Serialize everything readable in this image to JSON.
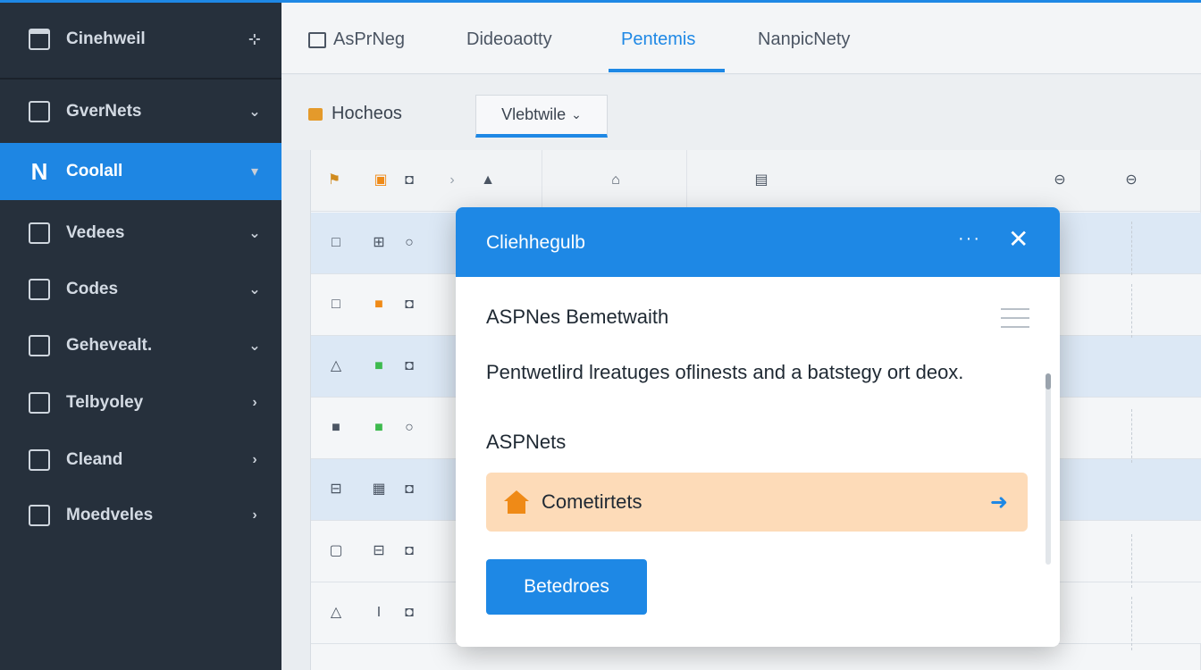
{
  "sidebar": {
    "header": {
      "label": "Cinehweil",
      "icon": "window-icon",
      "action": "pin-icon"
    },
    "items": [
      {
        "label": "GverNets",
        "icon": "download-icon",
        "chevron": "⌄"
      },
      {
        "label": "Coolall",
        "icon": "n-logo-icon",
        "chevron": "▾",
        "active": true
      },
      {
        "label": "Vedees",
        "icon": "square-icon",
        "chevron": "⌄"
      },
      {
        "label": "Codes",
        "icon": "code-icon",
        "chevron": "⌄"
      },
      {
        "label": "Gehevealt.",
        "icon": "square-icon",
        "chevron": "⌄"
      },
      {
        "label": "Telbyoley",
        "icon": "panel-icon",
        "chevron": "›"
      },
      {
        "label": "Cleand",
        "icon": "layout-icon",
        "chevron": "›"
      },
      {
        "label": "Moedveles",
        "icon": "module-icon",
        "chevron": "›"
      }
    ]
  },
  "topbar": {
    "tabs": [
      {
        "label": "AsPrNeg",
        "icon": "frame-icon"
      },
      {
        "label": "Dideoaotty"
      },
      {
        "label": "Pentemis",
        "active": true
      },
      {
        "label": "NanpicNety"
      }
    ]
  },
  "toolbar": {
    "title": "Hocheos",
    "dropdown": "Vlebtwile",
    "dropdown_chevron": "⌄"
  },
  "grid": {
    "header_icons": [
      "⚑",
      "▣",
      "◘",
      "›",
      "▲",
      "⌂",
      "▤",
      "⊖",
      "⊖"
    ],
    "rows": [
      {
        "icons": [
          "□",
          "⊞",
          "○"
        ],
        "highlight": true
      },
      {
        "icons": [
          "□",
          "■",
          "◘"
        ],
        "highlight": false
      },
      {
        "icons": [
          "△",
          "■",
          "◘"
        ],
        "highlight": true
      },
      {
        "icons": [
          "■",
          "■",
          "○"
        ],
        "highlight": false
      },
      {
        "icons": [
          "⊟",
          "▦",
          "◘"
        ],
        "highlight": true
      },
      {
        "icons": [
          "▢",
          "⊟",
          "◘"
        ],
        "highlight": false
      },
      {
        "icons": [
          "△",
          "I",
          "◘"
        ],
        "highlight": false
      }
    ]
  },
  "modal": {
    "title": "Cliehhegulb",
    "more": "···",
    "close": "✕",
    "subtitle": "ASPNes Bemetwaith",
    "paragraph": "Pentwetlird lreatuges oflinests and a batstegy ort deox.",
    "label": "ASPNets",
    "card_label": "Cometirtets",
    "card_arrow": "➜",
    "button": "Betedroes"
  },
  "colors": {
    "accent": "#1e88e5",
    "sidebar_bg": "#26303c",
    "card_bg": "#fddbb8",
    "card_icon": "#ef8a17"
  }
}
